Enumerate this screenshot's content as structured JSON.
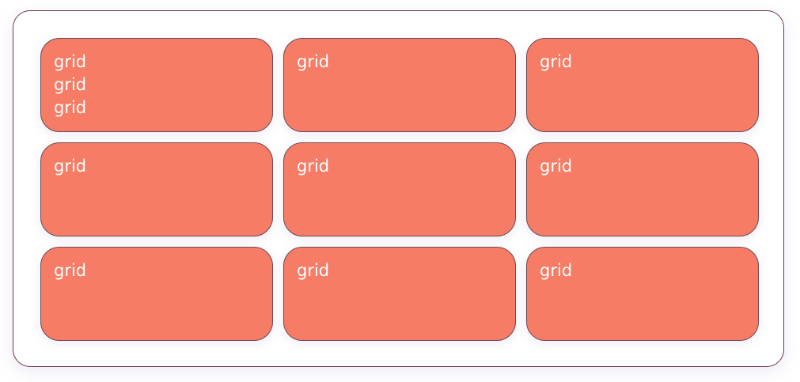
{
  "grid": {
    "cells": [
      {
        "lines": [
          "grid",
          "grid",
          "grid"
        ]
      },
      {
        "lines": [
          "grid"
        ]
      },
      {
        "lines": [
          "grid"
        ]
      },
      {
        "lines": [
          "grid"
        ]
      },
      {
        "lines": [
          "grid"
        ]
      },
      {
        "lines": [
          "grid"
        ]
      },
      {
        "lines": [
          "grid"
        ]
      },
      {
        "lines": [
          "grid"
        ]
      },
      {
        "lines": [
          "grid"
        ]
      }
    ]
  },
  "colors": {
    "cell_background": "#f67c66",
    "cell_border": "#6e4a55",
    "cell_text": "#ffffff",
    "container_border": "#6b3a52",
    "page_background": "#ffffff"
  }
}
